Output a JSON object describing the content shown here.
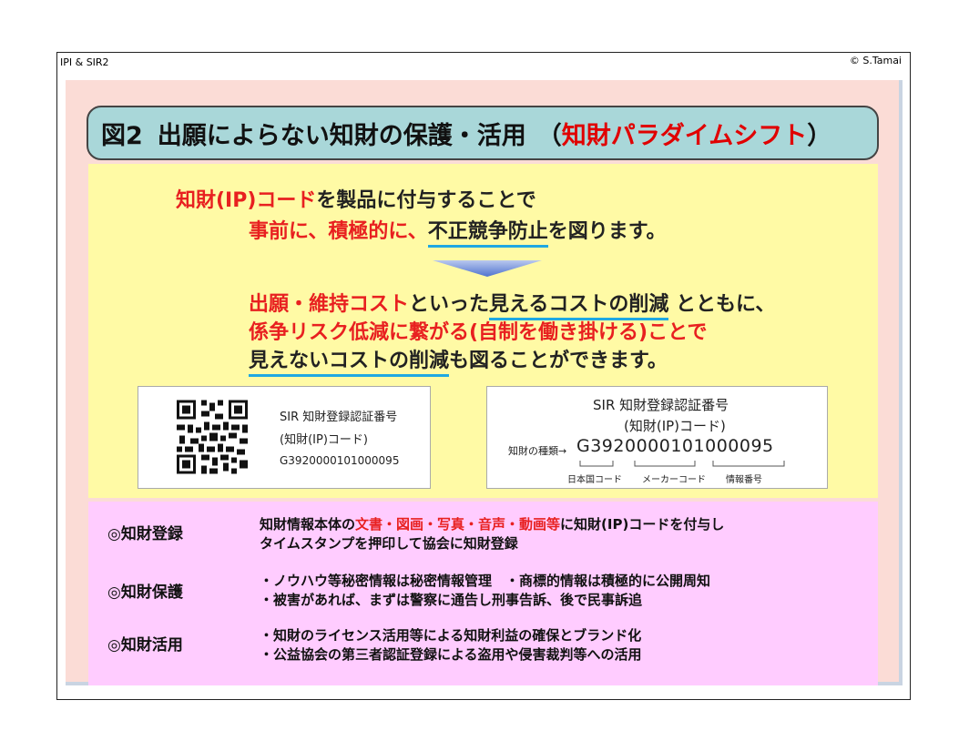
{
  "header": {
    "left": "IPI & SIR2",
    "right": "© S.Tamai"
  },
  "title": {
    "fig": "図2",
    "main": "出願によらない知財の保護・活用",
    "paren_open": "（",
    "highlight": "知財パラダイムシフト",
    "paren_close": "）"
  },
  "top": {
    "l1_red": "知財(IP)コード",
    "l1_rest": "を製品に付与することで",
    "l2_red": "事前に、積極的に、",
    "l2_ul": "不正競争防止",
    "l2_rest": "を図ります。"
  },
  "middle": {
    "l1_red": "出願・維持コスト",
    "l1_mid": "といった",
    "l1_ul": "見えるコストの削減",
    "l1_rest": " とともに、",
    "l2": "係争リスク低減に繋がる(自制を働き掛ける)ことで",
    "l3_ul": "見えないコストの削減",
    "l3_rest": "も図ることができます。"
  },
  "card1": {
    "line1": "SIR 知財登録認証番号",
    "line2": "(知財(IP)コード)",
    "code": "G3920000101000095",
    "qr_icon": "qr-code-icon"
  },
  "card2": {
    "line1": "SIR 知財登録認証番号",
    "line2": "(知財(IP)コード)",
    "kind": "知財の種類→",
    "code": "G3920000101000095",
    "part1": "日本国コード",
    "part2": "メーカーコード",
    "part3": "情報番号"
  },
  "items": [
    {
      "label": "◎知財登録",
      "l1_pre": "知財情報本体の",
      "l1_red": "文書・図画・写真・音声・動画等",
      "l1_post": "に知財(IP)コードを付与し",
      "l2": "タイムスタンプを押印して協会に知財登録"
    },
    {
      "label": "◎知財保護",
      "l1": "・ノウハウ等秘密情報は秘密情報管理　・商標的情報は積極的に公開周知",
      "l2": "・被害があれば、まずは警察に通告し刑事告訴、後で民事訴追"
    },
    {
      "label": "◎知財活用",
      "l1": "・知財のライセンス活用等による知財利益の確保とブランド化",
      "l2": "・公益協会の第三者認証登録による盗用や侵害裁判等への活用"
    }
  ],
  "colors": {
    "red": "#e82020",
    "underline": "#1fa8e2",
    "title_bg": "#a9d7d9",
    "yellow_bg": "#fffaa5",
    "pink_bg": "#ffccff"
  }
}
